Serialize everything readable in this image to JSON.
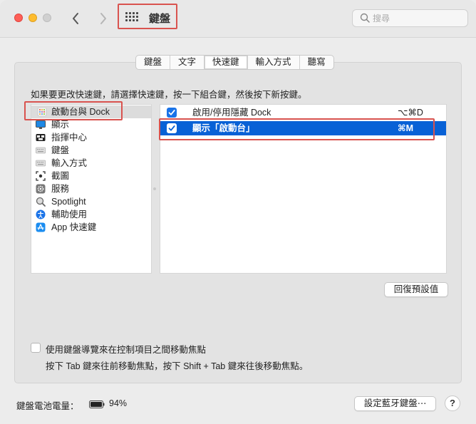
{
  "window": {
    "title": "鍵盤",
    "search_placeholder": "搜尋"
  },
  "tabs": [
    {
      "label": "鍵盤",
      "active": false
    },
    {
      "label": "文字",
      "active": false
    },
    {
      "label": "快速鍵",
      "active": true
    },
    {
      "label": "輸入方式",
      "active": false
    },
    {
      "label": "聽寫",
      "active": false
    }
  ],
  "instruction": "如果要更改快速鍵，請選擇快速鍵，按一下組合鍵，然後按下新按鍵。",
  "categories": [
    {
      "label": "啟動台與 Dock",
      "icon": "launchpad-icon",
      "selected": true
    },
    {
      "label": "顯示",
      "icon": "display-icon",
      "selected": false
    },
    {
      "label": "指揮中心",
      "icon": "mission-control-icon",
      "selected": false
    },
    {
      "label": "鍵盤",
      "icon": "keyboard-icon",
      "selected": false
    },
    {
      "label": "輸入方式",
      "icon": "input-sources-icon",
      "selected": false
    },
    {
      "label": "截圖",
      "icon": "screenshot-icon",
      "selected": false
    },
    {
      "label": "服務",
      "icon": "services-gear-icon",
      "selected": false
    },
    {
      "label": "Spotlight",
      "icon": "spotlight-icon",
      "selected": false
    },
    {
      "label": "輔助使用",
      "icon": "accessibility-icon",
      "selected": false
    },
    {
      "label": "App 快速鍵",
      "icon": "app-store-icon",
      "selected": false
    }
  ],
  "shortcuts": [
    {
      "label": "啟用/停用隱藏 Dock",
      "keys": "⌥⌘D",
      "checked": true,
      "selected": false
    },
    {
      "label": "顯示「啟動台」",
      "keys": "⌘M",
      "checked": true,
      "selected": true
    }
  ],
  "restore_button": "回復預設值",
  "keyboard_navigation": {
    "label": "使用鍵盤導覽來在控制項目之間移動焦點",
    "checked": false,
    "note": "按下 Tab 鍵來往前移動焦點，按下 Shift + Tab 鍵來往後移動焦點。"
  },
  "battery": {
    "label": "鍵盤電池電量：",
    "percent": "94%"
  },
  "bluetooth_button": "設定藍牙鍵盤⋯",
  "help_button": "?",
  "colors": {
    "accent": "#0861d6",
    "highlight_box": "#d9534f"
  }
}
